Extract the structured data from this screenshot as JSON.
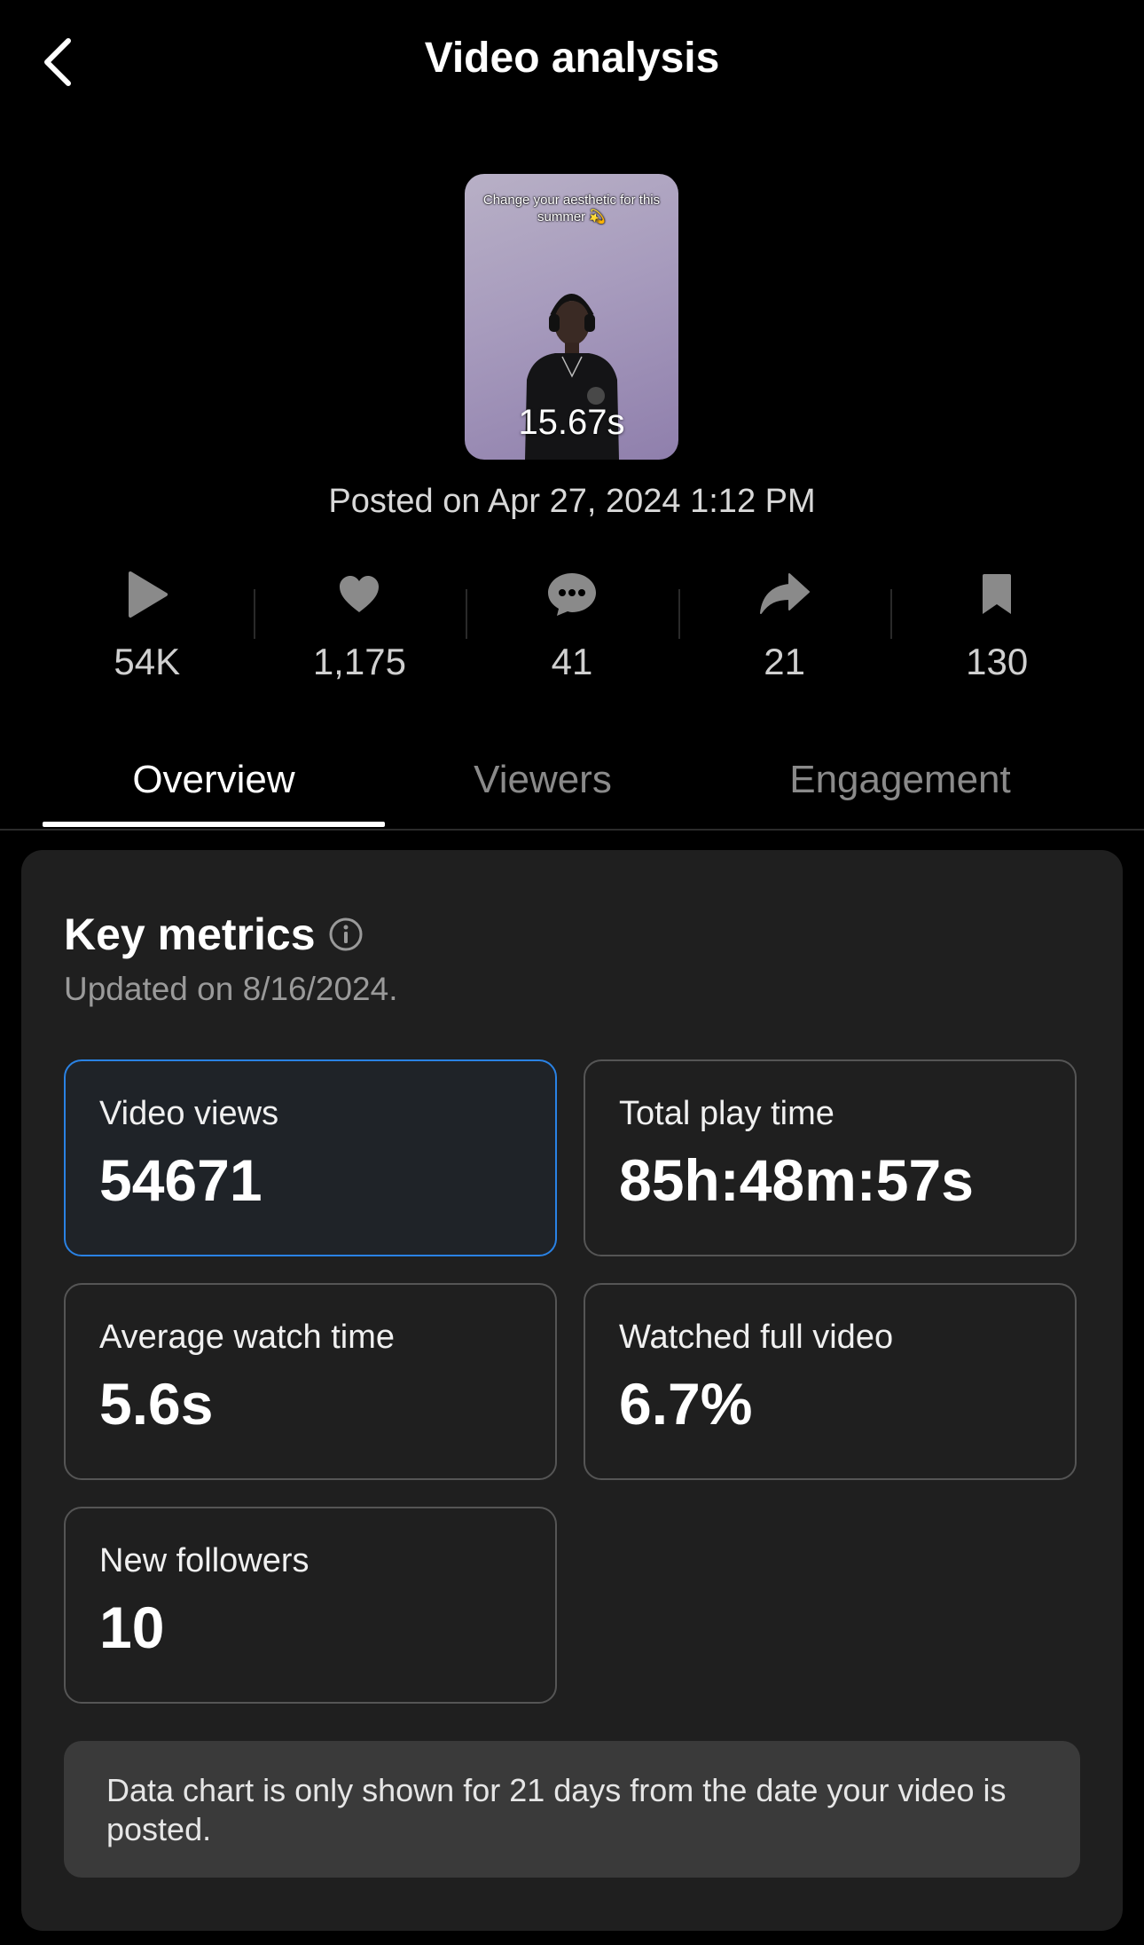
{
  "header": {
    "title": "Video analysis",
    "back_icon": "chevron-left-icon"
  },
  "video": {
    "caption": "Change your aesthetic for this summer 💫",
    "duration": "15.67s",
    "posted": "Posted on Apr 27, 2024 1:12 PM"
  },
  "stats": [
    {
      "icon": "play-icon",
      "value": "54K"
    },
    {
      "icon": "heart-icon",
      "value": "1,175"
    },
    {
      "icon": "comment-icon",
      "value": "41"
    },
    {
      "icon": "share-icon",
      "value": "21"
    },
    {
      "icon": "bookmark-icon",
      "value": "130"
    }
  ],
  "tabs": [
    {
      "label": "Overview",
      "active": true
    },
    {
      "label": "Viewers",
      "active": false
    },
    {
      "label": "Engagement",
      "active": false
    }
  ],
  "key_metrics": {
    "title": "Key metrics",
    "updated": "Updated on 8/16/2024.",
    "metrics": [
      {
        "label": "Video views",
        "value": "54671",
        "selected": true
      },
      {
        "label": "Total play time",
        "value": "85h:48m:57s",
        "selected": false
      },
      {
        "label": "Average watch time",
        "value": "5.6s",
        "selected": false
      },
      {
        "label": "Watched full video",
        "value": "6.7%",
        "selected": false
      },
      {
        "label": "New followers",
        "value": "10",
        "selected": false
      }
    ],
    "note": "Data chart is only shown for 21 days from the date your video is posted."
  },
  "colors": {
    "background": "#000000",
    "card": "#1f1f1f",
    "selected_border": "#2a82e4",
    "note_bg": "#3a3a3a"
  }
}
